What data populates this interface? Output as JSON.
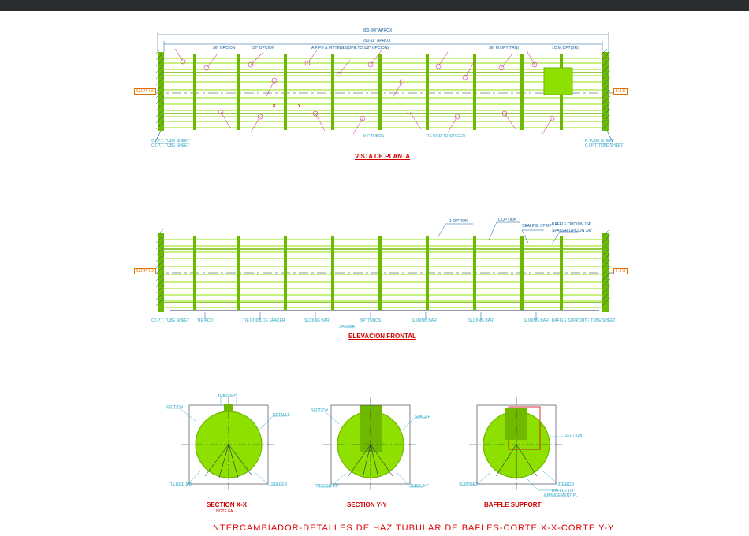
{
  "header": {},
  "page": {
    "title": "INTERCAMBIADOR-DETALLES DE HAZ TUBULAR DE BAFLES-CORTE X-X-CORTE Y-Y"
  },
  "views": {
    "plan": {
      "title": "VISTA DE PLANTA",
      "tag_left": "C.I.P.TS",
      "tag_right": "F.TS",
      "dim_top_outer": "300-3/4\" APROX",
      "dim_top_inner": "290-11\" APROX",
      "label_a": "36\" OPCION",
      "label_b": "36\" OPCION",
      "label_c": "A PIPE & FITTINGS(OPE.TO 1/2\" OPCION)",
      "label_d": "36\" M.OPT(TRN)",
      "label_e": "1C M.OPT(BR)",
      "label_f": "Y",
      "label_g": "X",
      "label_h": "C.I.P.T. TUBE SHEET",
      "label_i": "C.I.P.T. TUBE SHEET",
      "label_j": "3/4\" TUBOS",
      "label_k": "TIE ROD TO SPACER",
      "label_l": "F. TUBE SHEET",
      "label_m": "C.I.P.T. TUBE SHEET"
    },
    "elev": {
      "title": "ELEVACION FRONTAL",
      "tag_left": "C.I.P.TS",
      "tag_right": "F.TS",
      "label_a": "1-OPTION",
      "label_b": "L.OPTION",
      "label_c": "SEALING STRIP",
      "label_d": "SPACER OPCION 3/8\"",
      "label_e": "BAFFLE OPCION 1/4\"",
      "label_f": "TIE ROD",
      "label_g": "TIE RODS DE SPACER",
      "label_h": "SLIDING BAR",
      "label_i": "3/4\" TUBOS",
      "label_j": "SLIDING BAR",
      "label_k": "SLIDING BAR",
      "label_l": "SLIDING BAR",
      "label_m": "SPACER",
      "label_n": "BAFFLE SUPPORT",
      "label_o": "F. TUBE SHEET",
      "label_p": "C.I.P.T. TUBE SHEET"
    },
    "secxx": {
      "title": "SECTION X-X",
      "sub": "NOTE 6A",
      "label_a": "SECTION",
      "label_b": "DETALLE",
      "label_c": "TIE ROD 5/8\"",
      "label_d": "SPACER",
      "label_e": "TUBO 3/4\""
    },
    "secyy": {
      "title": "SECTION Y-Y",
      "label_a": "SECTION",
      "label_b": "SPACER",
      "label_c": "TIE ROD 5/8\"",
      "label_d": "TUBO 3/4\""
    },
    "baffle": {
      "title": "BAFFLE SUPPORT",
      "label_a": "SECTION",
      "label_b": "SUPPORT",
      "label_c": "TIE ROD",
      "label_d": "BAFFLE 1/4\"",
      "label_e": "IMPINGEMENT PL"
    }
  },
  "colors": {
    "lime": "#8ee000",
    "lime_dk": "#6fb800",
    "cyan": "#2aa8c7",
    "blue": "#0a599a",
    "red": "#d00000",
    "orange": "#e07000",
    "magenta": "#d040a0",
    "dark": "#253040"
  }
}
